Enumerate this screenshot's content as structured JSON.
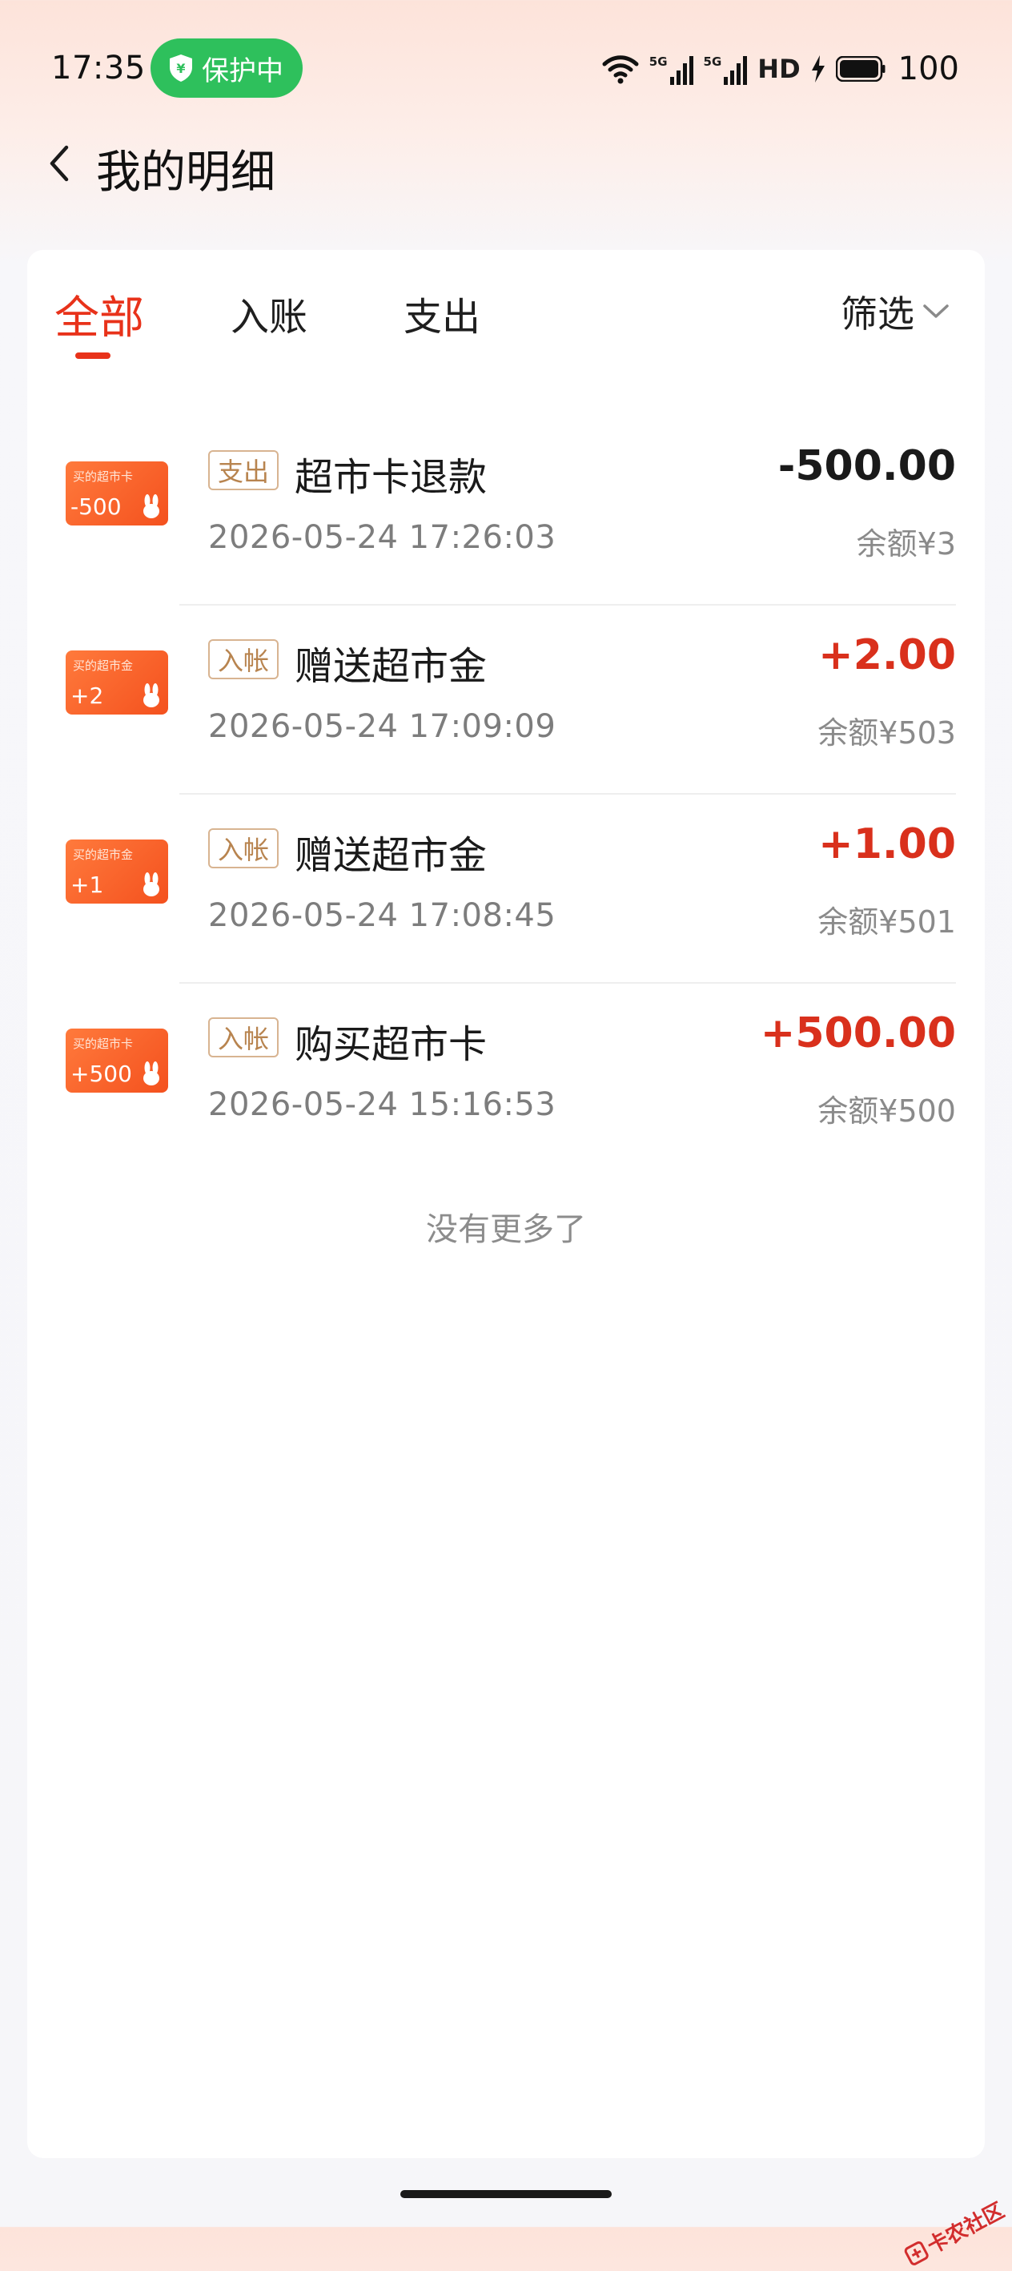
{
  "status_bar": {
    "time": "17:35",
    "protection_label": "保护中",
    "network_label": "5G",
    "network_label_2": "5G",
    "hd_label": "HD",
    "battery_level": "100"
  },
  "header": {
    "title": "我的明细"
  },
  "tabs": [
    {
      "label": "全部",
      "active": true
    },
    {
      "label": "入账",
      "active": false
    },
    {
      "label": "支出",
      "active": false
    }
  ],
  "filter": {
    "label": "筛选"
  },
  "records": [
    {
      "thumb_title": "买的超市卡",
      "thumb_amount": "-500",
      "type_label": "支出",
      "title": "超市卡退款",
      "time": "2026-05-24 17:26:03",
      "amount": "-500.00",
      "balance": "余额¥3"
    },
    {
      "thumb_title": "买的超市金",
      "thumb_amount": "+2",
      "type_label": "入帐",
      "title": "赠送超市金",
      "time": "2026-05-24 17:09:09",
      "amount": "+2.00",
      "balance": "余额¥503"
    },
    {
      "thumb_title": "买的超市金",
      "thumb_amount": "+1",
      "type_label": "入帐",
      "title": "赠送超市金",
      "time": "2026-05-24 17:08:45",
      "amount": "+1.00",
      "balance": "余额¥501"
    },
    {
      "thumb_title": "买的超市卡",
      "thumb_amount": "+500",
      "type_label": "入帐",
      "title": "购买超市卡",
      "time": "2026-05-24 15:16:53",
      "amount": "+500.00",
      "balance": "余额¥500"
    }
  ],
  "no_more_text": "没有更多了",
  "watermark": "卡农社区",
  "colors": {
    "accent": "#e8321a",
    "income": "#d9301c",
    "badge_border": "#d8b491",
    "protect_green": "#2ec05c"
  }
}
